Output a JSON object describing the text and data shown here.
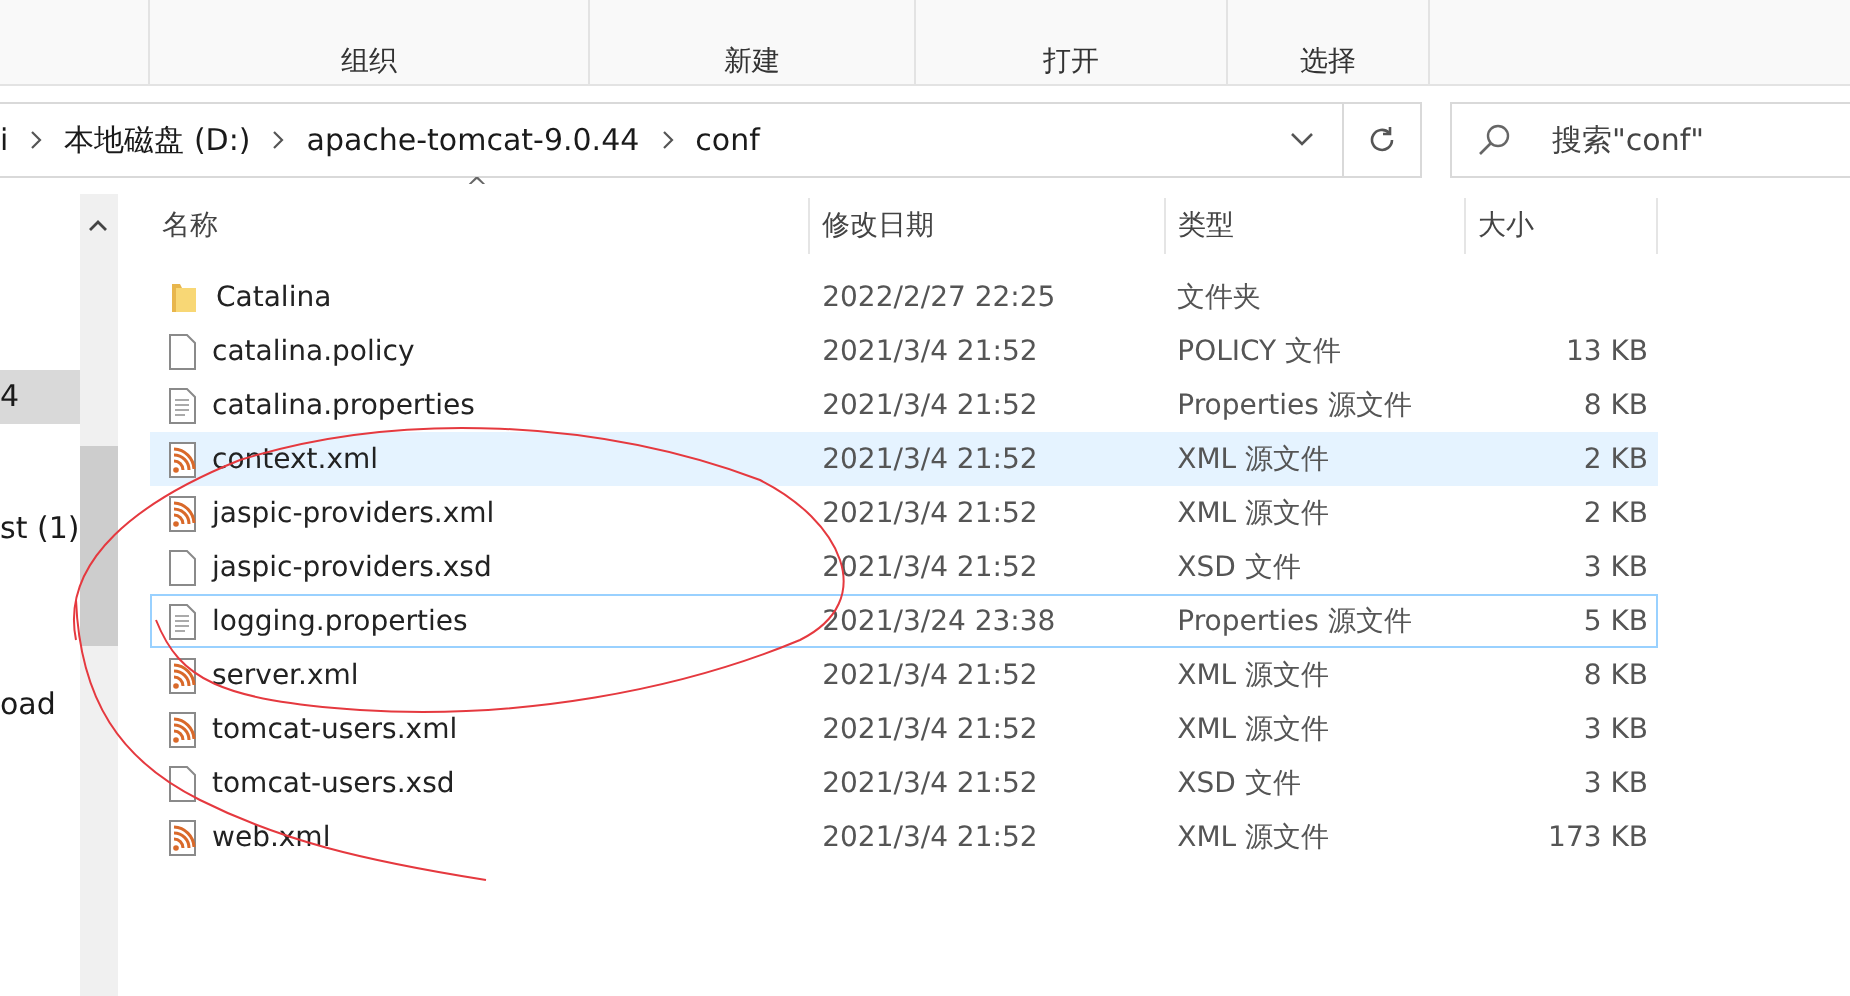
{
  "ribbon": {
    "groups": [
      "组织",
      "新建",
      "打开",
      "选择"
    ]
  },
  "address_bar": {
    "crumbs": [
      "i",
      "本地磁盘 (D:)",
      "apache-tomcat-9.0.44",
      "conf"
    ]
  },
  "search": {
    "placeholder": "搜索\"conf\""
  },
  "nav_pane": {
    "items": [
      {
        "label": "4",
        "selected": true
      },
      {
        "label": "st (1)",
        "selected": false
      },
      {
        "label": "oad",
        "selected": false
      }
    ]
  },
  "table": {
    "sort_indicator": "^",
    "columns": [
      "名称",
      "修改日期",
      "类型",
      "大小"
    ],
    "rows": [
      {
        "kind": "folder",
        "name": "Catalina",
        "date": "2022/2/27 22:25",
        "type": "文件夹",
        "size": "",
        "hovered": false,
        "focused": false
      },
      {
        "kind": "blank",
        "name": "catalina.policy",
        "date": "2021/3/4 21:52",
        "type": "POLICY 文件",
        "size": "13 KB",
        "hovered": false,
        "focused": false
      },
      {
        "kind": "text",
        "name": "catalina.properties",
        "date": "2021/3/4 21:52",
        "type": "Properties 源文件",
        "size": "8 KB",
        "hovered": false,
        "focused": false
      },
      {
        "kind": "xml",
        "name": "context.xml",
        "date": "2021/3/4 21:52",
        "type": "XML 源文件",
        "size": "2 KB",
        "hovered": true,
        "focused": false
      },
      {
        "kind": "xml",
        "name": "jaspic-providers.xml",
        "date": "2021/3/4 21:52",
        "type": "XML 源文件",
        "size": "2 KB",
        "hovered": false,
        "focused": false
      },
      {
        "kind": "blank",
        "name": "jaspic-providers.xsd",
        "date": "2021/3/4 21:52",
        "type": "XSD 文件",
        "size": "3 KB",
        "hovered": false,
        "focused": false
      },
      {
        "kind": "text",
        "name": "logging.properties",
        "date": "2021/3/24 23:38",
        "type": "Properties 源文件",
        "size": "5 KB",
        "hovered": false,
        "focused": true
      },
      {
        "kind": "xml",
        "name": "server.xml",
        "date": "2021/3/4 21:52",
        "type": "XML 源文件",
        "size": "8 KB",
        "hovered": false,
        "focused": false
      },
      {
        "kind": "xml",
        "name": "tomcat-users.xml",
        "date": "2021/3/4 21:52",
        "type": "XML 源文件",
        "size": "3 KB",
        "hovered": false,
        "focused": false
      },
      {
        "kind": "blank",
        "name": "tomcat-users.xsd",
        "date": "2021/3/4 21:52",
        "type": "XSD 文件",
        "size": "3 KB",
        "hovered": false,
        "focused": false
      },
      {
        "kind": "xml",
        "name": "web.xml",
        "date": "2021/3/4 21:52",
        "type": "XML 源文件",
        "size": "173 KB",
        "hovered": false,
        "focused": false
      }
    ]
  }
}
